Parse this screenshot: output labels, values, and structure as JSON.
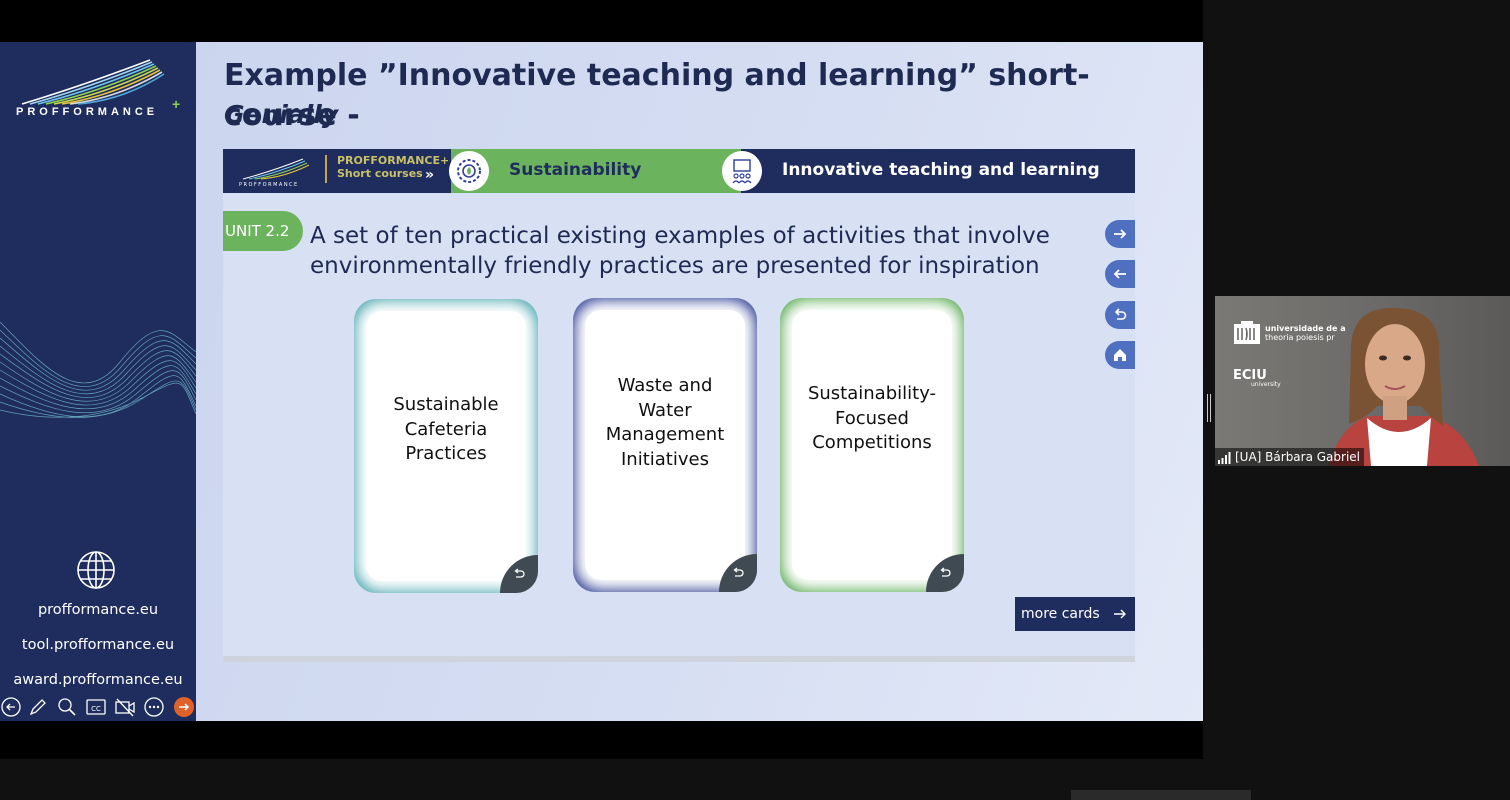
{
  "sidebar": {
    "brand": "PROFFORMANCE",
    "brand_plus": "+",
    "links": [
      "profformance.eu",
      "tool.profformance.eu",
      "award.profformance.eu"
    ]
  },
  "slide": {
    "title": "Example ”Innovative teaching and learning” short-course -",
    "subtitle": "Genially"
  },
  "banner": {
    "brand_label_line1": "PROFFORMANCE+",
    "brand_label_line2": "Short courses",
    "arrows": "»",
    "topic": "Sustainability",
    "course": "Innovative teaching and learning"
  },
  "unit": {
    "tag": "UNIT 2.2",
    "lead": "A set of ten practical existing examples of activities that involve environmentally friendly practices are presented for inspiration"
  },
  "cards": [
    {
      "lines": [
        "Sustainable",
        "Cafeteria",
        "Practices"
      ],
      "color": "#4fa8b0"
    },
    {
      "lines": [
        "Waste and",
        "Water",
        "Management",
        "Initiatives"
      ],
      "color": "#2f3f95"
    },
    {
      "lines": [
        "Sustainability-",
        "Focused",
        "Competitions"
      ],
      "color": "#5aab52"
    }
  ],
  "more_cards_label": "more cards",
  "nav_icons": [
    "arrow-right-icon",
    "arrow-left-icon",
    "undo-icon",
    "home-icon"
  ],
  "controls": [
    "back-icon",
    "pen-icon",
    "zoom-icon",
    "cc-icon",
    "video-off-icon",
    "more-icon",
    "forward-icon"
  ],
  "video": {
    "participant_name": "[UA] Bárbara Gabriel",
    "logo_line1": "universidade de a",
    "logo_line2": "theoria poiesis pr",
    "eciu": "ECIU",
    "eciu_sub": "university"
  },
  "colors": {
    "navy": "#1f2d5e",
    "green": "#6bb35c",
    "accent_orange": "#e0622a"
  }
}
